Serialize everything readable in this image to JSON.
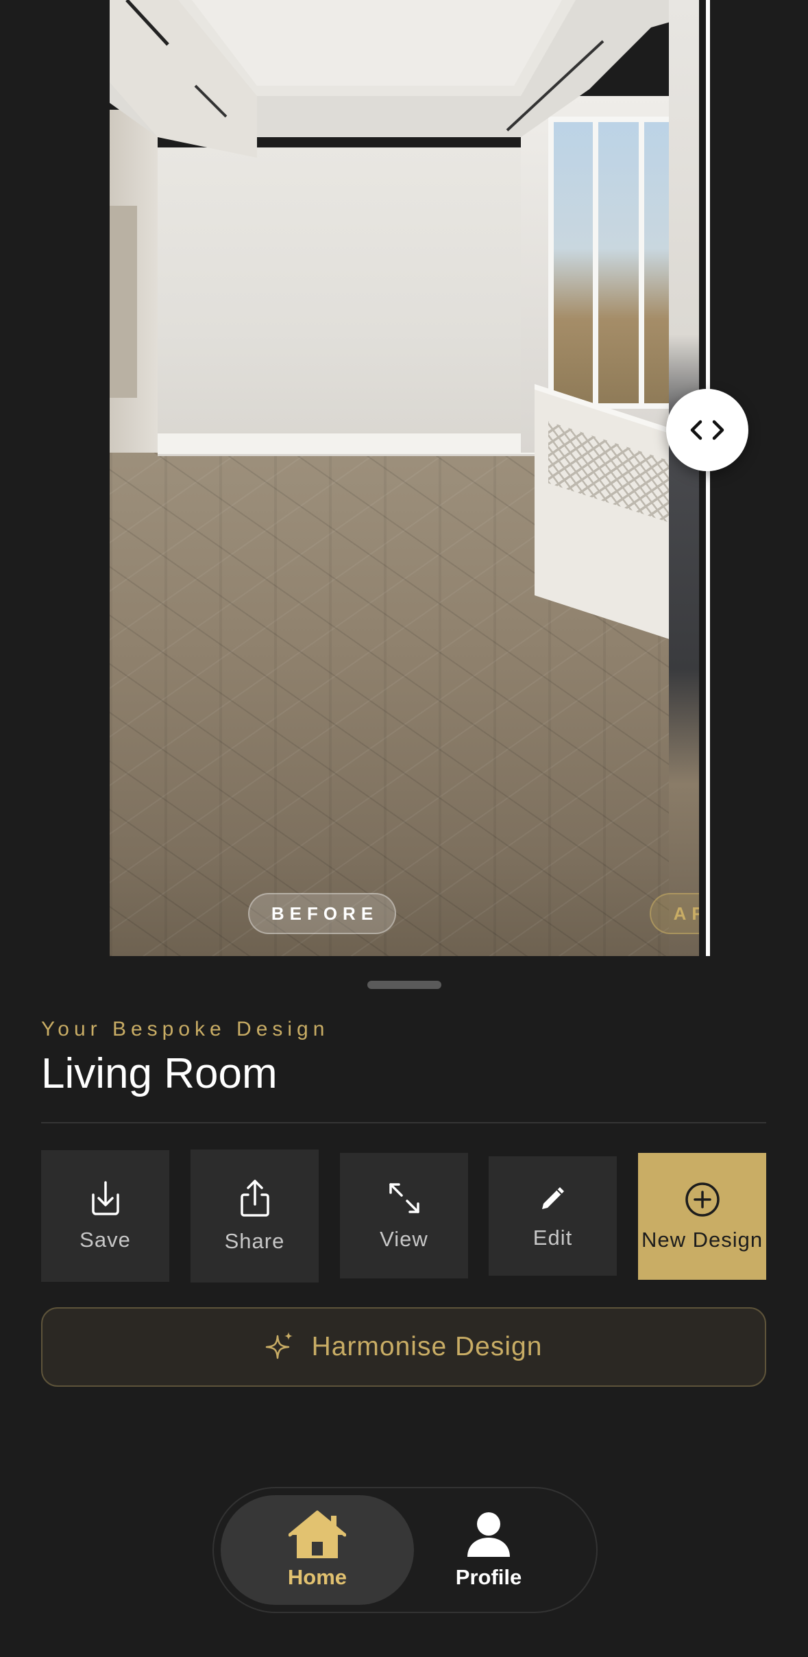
{
  "compare": {
    "before_label": "BEFORE",
    "after_label": "AFTER",
    "handle_icon": "chevrons-left-right-icon"
  },
  "design": {
    "eyebrow": "Your Bespoke Design",
    "title": "Living Room"
  },
  "actions": [
    {
      "label": "Save",
      "icon": "download-icon"
    },
    {
      "label": "Share",
      "icon": "share-icon"
    },
    {
      "label": "View",
      "icon": "expand-icon"
    },
    {
      "label": "Edit",
      "icon": "pencil-icon"
    },
    {
      "label": "New Design",
      "icon": "plus-circle-icon"
    }
  ],
  "harmonise": {
    "label": "Harmonise Design",
    "icon": "sparkle-icon"
  },
  "tabs": {
    "home": {
      "label": "Home",
      "icon": "home-icon",
      "active": true
    },
    "profile": {
      "label": "Profile",
      "icon": "person-icon",
      "active": false
    }
  },
  "colors": {
    "background": "#1c1c1c",
    "accent": "#c9ad65",
    "card": "#2c2c2c"
  }
}
